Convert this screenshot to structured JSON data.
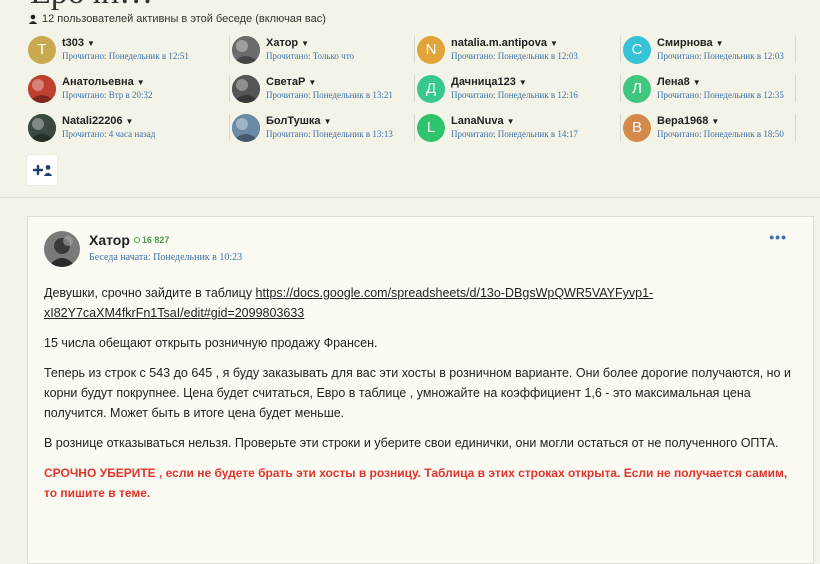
{
  "active": {
    "text": "12 пользователей активны в этой беседе (включая вас)"
  },
  "users": [
    {
      "name": "t303",
      "read": "Прочитано: Понедельник в 12:51",
      "letter": "T",
      "color": "#c9a94e",
      "photo": false
    },
    {
      "name": "Хатор",
      "read": "Прочитано: Только что",
      "letter": "",
      "color": "#6b6b6b",
      "photo": true
    },
    {
      "name": "natalia.m.antipova",
      "read": "Прочитано: Понедельник в 12:03",
      "letter": "N",
      "color": "#e0a43a",
      "photo": false
    },
    {
      "name": "Смирнова",
      "read": "Прочитано: Понедельник в 12:03",
      "letter": "C",
      "color": "#36c3d6",
      "photo": false
    },
    {
      "name": "Анатольевна",
      "read": "Прочитано: Втр в 20:32",
      "letter": "",
      "color": "#c04030",
      "photo": true
    },
    {
      "name": "СветаР",
      "read": "Прочитано: Понедельник в 13:21",
      "letter": "",
      "color": "#555555",
      "photo": true
    },
    {
      "name": "Дачница123",
      "read": "Прочитано: Понедельник в 12:16",
      "letter": "Д",
      "color": "#37c98b",
      "photo": false
    },
    {
      "name": "Лена8",
      "read": "Прочитано: Понедельник в 12:35",
      "letter": "Л",
      "color": "#40c77f",
      "photo": false
    },
    {
      "name": "Natali22206",
      "read": "Прочитано: 4 часа назад",
      "letter": "",
      "color": "#3a4a40",
      "photo": true
    },
    {
      "name": "БолТушка",
      "read": "Прочитано: Понедельник в 13:13",
      "letter": "",
      "color": "#6a8aa8",
      "photo": true
    },
    {
      "name": "LanaNuva",
      "read": "Прочитано: Понедельник в 14:17",
      "letter": "L",
      "color": "#2ec46b",
      "photo": false
    },
    {
      "name": "Вера1968",
      "read": "Прочитано: Понедельник в 18:50",
      "letter": "B",
      "color": "#d48a4a",
      "photo": false
    }
  ],
  "post": {
    "author": "Хатор",
    "reputation": "16 827",
    "started": "Беседа начата: Понедельник в 10:23",
    "menu": "•••",
    "p1_prefix": "Девушки, срочно зайдите в таблицу ",
    "link": "https://docs.google.com/spreadsheets/d/13o-DBgsWpQWR5VAYFyvp1-xI82Y7caXM4fkrFn1TsaI/edit#gid=2099803633",
    "p2": "15 числа обещают открыть розничную продажу Франсен.",
    "p3": "Теперь из  строк с 543 до 645 , я буду заказывать для вас эти хосты в розничном варианте. Они более дорогие получаются, но и корни будут покрупнее. Цена  будет считаться, Евро в таблице , умножайте на коэффициент 1,6 - это максимальная цена получится. Может быть в итоге цена будет меньше.",
    "p4": "В рознице отказываться нельзя.  Проверьте эти строки и уберите свои единички, они могли остаться от не полученного ОПТА.",
    "p5": "СРОЧНО УБЕРИТЕ , если не будете брать эти хосты в розницу. Таблица в этих строках открыта. Если не получается самим, то пишите в теме."
  },
  "icons": {
    "invite": "add-user-icon",
    "person": "person-icon",
    "reputation": "reputation-icon"
  }
}
